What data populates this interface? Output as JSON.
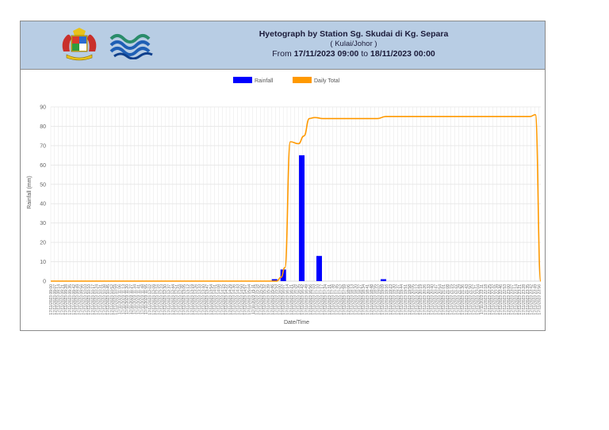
{
  "header": {
    "title": "Hyetograph by Station  Sg. Skudai di Kg. Separa",
    "subtitle": "( Kulai/Johor )",
    "range_prefix": "From",
    "range_from": "17/11/2023 09:00",
    "range_mid": "to",
    "range_to": "18/11/2023 00:00"
  },
  "colors": {
    "header_bg": "#b8cde4",
    "rainfall": "#0000ff",
    "daily_total": "#ff9900",
    "grid": "#e2e2e2"
  },
  "chart_data": {
    "type": "bar",
    "title": "",
    "xlabel": "Date/Time",
    "ylabel": "Rainfall (mm)",
    "ylim": [
      0,
      90
    ],
    "yticks": [
      0,
      10,
      20,
      30,
      40,
      50,
      60,
      70,
      80,
      90
    ],
    "grid": true,
    "legend_position": "top-center",
    "x_range": [
      "17/11/2023 09:00",
      "18/11/2023 00:00"
    ],
    "x_tick_labels_every_minutes": 7,
    "series": [
      {
        "name": "Rainfall",
        "type": "bar",
        "color": "#0000ff",
        "points": [
          {
            "x": "17/11/2023 15:51",
            "y": 1
          },
          {
            "x": "17/11/2023 16:07",
            "y": 6
          },
          {
            "x": "17/11/2023 16:41",
            "y": 65
          },
          {
            "x": "17/11/2023 17:13",
            "y": 13
          },
          {
            "x": "17/11/2023 19:11",
            "y": 1
          }
        ]
      },
      {
        "name": "Daily Total",
        "type": "line",
        "color": "#ff9900",
        "points": [
          {
            "x": "17/11/2023 09:00",
            "y": 0
          },
          {
            "x": "17/11/2023 15:55",
            "y": 0
          },
          {
            "x": "17/11/2023 16:03",
            "y": 2
          },
          {
            "x": "17/11/2023 16:10",
            "y": 7
          },
          {
            "x": "17/11/2023 16:20",
            "y": 72
          },
          {
            "x": "17/11/2023 16:35",
            "y": 71
          },
          {
            "x": "17/11/2023 16:45",
            "y": 75
          },
          {
            "x": "17/11/2023 16:55",
            "y": 84
          },
          {
            "x": "17/11/2023 17:05",
            "y": 84.5
          },
          {
            "x": "17/11/2023 17:20",
            "y": 84
          },
          {
            "x": "17/11/2023 19:00",
            "y": 84
          },
          {
            "x": "17/11/2023 19:15",
            "y": 85
          },
          {
            "x": "17/11/2023 23:40",
            "y": 85
          },
          {
            "x": "17/11/2023 23:50",
            "y": 86
          },
          {
            "x": "18/11/2023 00:00",
            "y": 0
          }
        ]
      }
    ]
  }
}
